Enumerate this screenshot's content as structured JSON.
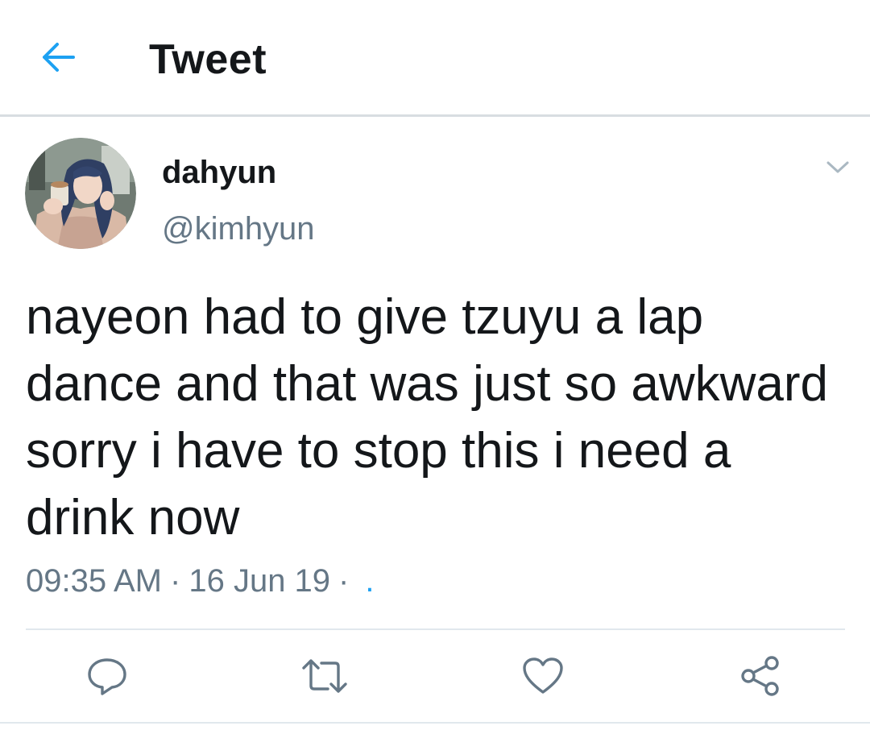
{
  "header": {
    "title": "Tweet",
    "back_icon": "arrow-left-icon"
  },
  "tweet": {
    "author": {
      "display_name": "dahyun",
      "handle": "@kimhyun",
      "avatar_icon": "user-avatar-photo"
    },
    "text": "nayeon had to give tzuyu a lap dance and that was just so awkward sorry i have to stop this i need a drink now",
    "time": "09:35 AM",
    "separator": "·",
    "date": "16 Jun 19",
    "source": ".",
    "menu_icon": "chevron-down-icon"
  },
  "actions": [
    {
      "name": "reply",
      "icon": "reply-icon"
    },
    {
      "name": "retweet",
      "icon": "retweet-icon"
    },
    {
      "name": "like",
      "icon": "heart-icon"
    },
    {
      "name": "share",
      "icon": "share-icon"
    }
  ],
  "colors": {
    "accent": "#1da1f2",
    "text_primary": "#14171a",
    "text_secondary": "#657786",
    "icon_gray": "#657786",
    "divider": "#e1e8ed"
  }
}
